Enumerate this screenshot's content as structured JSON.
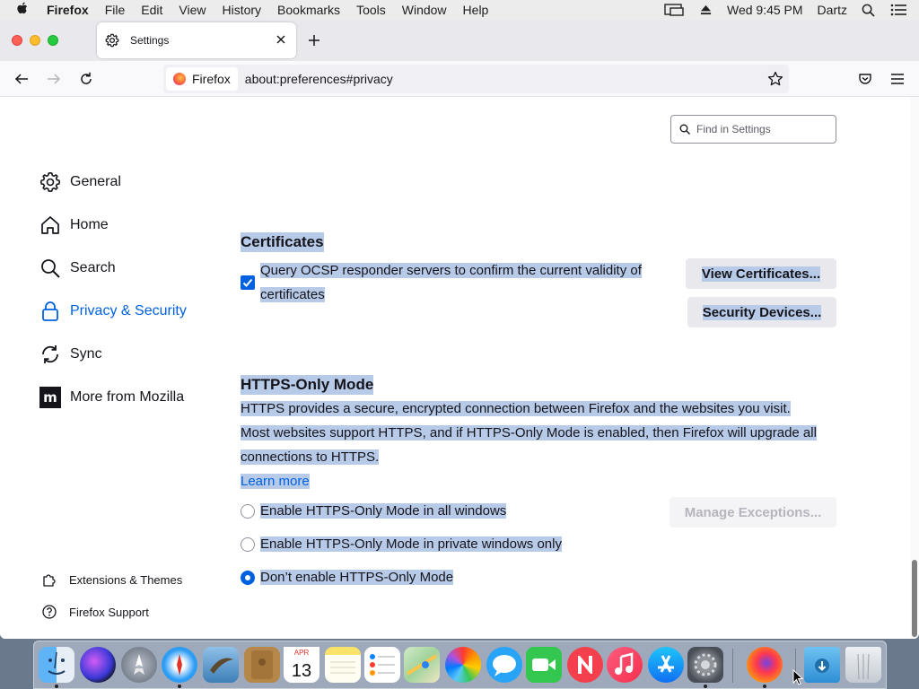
{
  "menubar": {
    "app_name": "Firefox",
    "items": [
      "File",
      "Edit",
      "View",
      "History",
      "Bookmarks",
      "Tools",
      "Window",
      "Help"
    ],
    "clock": "Wed 9:45 PM",
    "user": "Dartz"
  },
  "tabs": [
    {
      "title": "Settings",
      "icon": "gear-icon"
    }
  ],
  "urlbar": {
    "identity_label": "Firefox",
    "url": "about:preferences#privacy"
  },
  "search": {
    "placeholder": "Find in Settings"
  },
  "sidebar": {
    "categories": [
      {
        "label": "General",
        "icon": "gear-icon"
      },
      {
        "label": "Home",
        "icon": "home-icon"
      },
      {
        "label": "Search",
        "icon": "search-icon"
      },
      {
        "label": "Privacy & Security",
        "icon": "lock-icon",
        "selected": true
      },
      {
        "label": "Sync",
        "icon": "sync-icon"
      },
      {
        "label": "More from Mozilla",
        "icon": "mozilla-icon"
      }
    ],
    "footer": [
      {
        "label": "Extensions & Themes",
        "icon": "puzzle-icon"
      },
      {
        "label": "Firefox Support",
        "icon": "help-icon"
      }
    ]
  },
  "certificates": {
    "heading": "Certificates",
    "ocsp_label_line1": "Query OCSP responder servers to confirm the current validity of",
    "ocsp_label_line2": "certificates",
    "ocsp_checked": true,
    "view_button": "View Certificates...",
    "devices_button": "Security Devices..."
  },
  "https_only": {
    "heading": "HTTPS-Only Mode",
    "desc_line1": "HTTPS provides a secure, encrypted connection between Firefox and the websites you visit.",
    "desc_line2": "Most websites support HTTPS, and if HTTPS-Only Mode is enabled, then Firefox will upgrade all",
    "desc_line3": "connections to HTTPS.",
    "learn_more": "Learn more",
    "options": [
      "Enable HTTPS-Only Mode in all windows",
      "Enable HTTPS-Only Mode in private windows only",
      "Don’t enable HTTPS-Only Mode"
    ],
    "selected_option": 2,
    "exceptions_button": "Manage Exceptions..."
  },
  "dock": {
    "apps": [
      "Finder",
      "Siri",
      "Launchpad",
      "Safari",
      "Mail",
      "Contacts",
      "Calendar",
      "Notes",
      "Reminders",
      "Maps",
      "Photos",
      "Messages",
      "FaceTime",
      "News",
      "Music",
      "App Store",
      "System Preferences",
      "Firefox",
      "Downloads",
      "Trash"
    ],
    "calendar_month": "APR",
    "calendar_day": "13"
  },
  "colors": {
    "accent": "#0061e0",
    "selection": "#b7cbe9"
  }
}
